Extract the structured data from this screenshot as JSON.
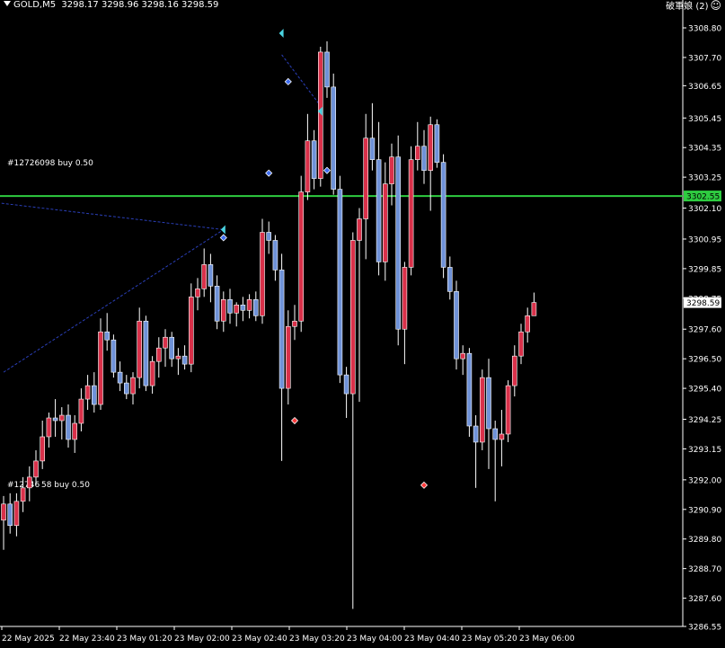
{
  "header": {
    "symbol_tf": "GOLD,M5",
    "ohlc": "3298.17 3298.96 3298.16 3298.59",
    "account": "破軍娘 (2)",
    "smiley": "☺"
  },
  "orders": [
    {
      "label": "#12726098 buy 0.50"
    },
    {
      "label": "#12746 58 buy 0.50"
    }
  ],
  "colors": {
    "background": "#000000",
    "bull": "#d9314a",
    "bear": "#6f92d8",
    "wick": "#ffffff",
    "hline": "#2ecc40",
    "order_arrow": "#4ad3e0",
    "trade_line": "#2a3fb8"
  },
  "chart_data": {
    "type": "candlestick",
    "symbol": "GOLD",
    "timeframe": "M5",
    "y_ticks": [
      "3308.80",
      "3307.70",
      "3306.65",
      "3305.45",
      "3304.35",
      "3303.25",
      "3302.10",
      "3300.95",
      "3299.85",
      "3298.75",
      "3297.60",
      "3296.50",
      "3295.40",
      "3294.25",
      "3293.15",
      "3292.00",
      "3290.90",
      "3289.80",
      "3288.70",
      "3287.60",
      "3286.55"
    ],
    "y_range": [
      3286.55,
      3308.8
    ],
    "x_labels": [
      "22 May 2025",
      "22 May 23:40",
      "23 May 01:20",
      "23 May 02:00",
      "23 May 02:40",
      "23 May 03:20",
      "23 May 04:00",
      "23 May 04:40",
      "23 May 05:20",
      "23 May 06:00"
    ],
    "horizontal_line": {
      "price": 3302.55,
      "label": "3302.55"
    },
    "current_price": {
      "price": 3298.59,
      "label": "3298.59"
    },
    "candles": [
      {
        "o": 3290.5,
        "h": 3291.4,
        "l": 3289.4,
        "c": 3291.1
      },
      {
        "o": 3291.1,
        "h": 3291.5,
        "l": 3290.0,
        "c": 3290.3
      },
      {
        "o": 3290.3,
        "h": 3291.5,
        "l": 3289.9,
        "c": 3291.2
      },
      {
        "o": 3291.2,
        "h": 3292.1,
        "l": 3290.8,
        "c": 3291.7
      },
      {
        "o": 3291.7,
        "h": 3292.5,
        "l": 3291.2,
        "c": 3292.1
      },
      {
        "o": 3292.1,
        "h": 3293.1,
        "l": 3291.8,
        "c": 3292.7
      },
      {
        "o": 3292.7,
        "h": 3294.2,
        "l": 3292.4,
        "c": 3293.6
      },
      {
        "o": 3293.6,
        "h": 3294.5,
        "l": 3293.2,
        "c": 3294.3
      },
      {
        "o": 3294.3,
        "h": 3295.0,
        "l": 3293.6,
        "c": 3294.2
      },
      {
        "o": 3294.2,
        "h": 3294.7,
        "l": 3293.5,
        "c": 3294.4
      },
      {
        "o": 3294.4,
        "h": 3294.8,
        "l": 3293.2,
        "c": 3293.5
      },
      {
        "o": 3293.5,
        "h": 3294.4,
        "l": 3293.0,
        "c": 3294.1
      },
      {
        "o": 3294.1,
        "h": 3295.4,
        "l": 3293.8,
        "c": 3295.0
      },
      {
        "o": 3295.0,
        "h": 3295.9,
        "l": 3294.6,
        "c": 3295.5
      },
      {
        "o": 3295.5,
        "h": 3296.0,
        "l": 3294.5,
        "c": 3294.8
      },
      {
        "o": 3294.8,
        "h": 3298.0,
        "l": 3294.6,
        "c": 3297.5
      },
      {
        "o": 3297.5,
        "h": 3298.2,
        "l": 3296.8,
        "c": 3297.2
      },
      {
        "o": 3297.2,
        "h": 3297.4,
        "l": 3295.8,
        "c": 3296.0
      },
      {
        "o": 3296.0,
        "h": 3296.4,
        "l": 3295.3,
        "c": 3295.6
      },
      {
        "o": 3295.6,
        "h": 3295.9,
        "l": 3295.0,
        "c": 3295.2
      },
      {
        "o": 3295.2,
        "h": 3296.0,
        "l": 3294.8,
        "c": 3295.8
      },
      {
        "o": 3295.8,
        "h": 3298.4,
        "l": 3295.4,
        "c": 3297.9
      },
      {
        "o": 3297.9,
        "h": 3298.1,
        "l": 3295.3,
        "c": 3295.5
      },
      {
        "o": 3295.5,
        "h": 3296.6,
        "l": 3295.2,
        "c": 3296.4
      },
      {
        "o": 3296.4,
        "h": 3297.3,
        "l": 3295.8,
        "c": 3296.9
      },
      {
        "o": 3296.9,
        "h": 3297.6,
        "l": 3296.2,
        "c": 3297.3
      },
      {
        "o": 3297.3,
        "h": 3297.5,
        "l": 3296.2,
        "c": 3296.5
      },
      {
        "o": 3296.5,
        "h": 3296.9,
        "l": 3295.9,
        "c": 3296.6
      },
      {
        "o": 3296.6,
        "h": 3297.0,
        "l": 3296.1,
        "c": 3296.3
      },
      {
        "o": 3296.3,
        "h": 3299.3,
        "l": 3296.0,
        "c": 3298.8
      },
      {
        "o": 3298.8,
        "h": 3299.5,
        "l": 3298.3,
        "c": 3299.1
      },
      {
        "o": 3299.1,
        "h": 3300.6,
        "l": 3298.8,
        "c": 3300.0
      },
      {
        "o": 3300.0,
        "h": 3300.4,
        "l": 3298.6,
        "c": 3299.2
      },
      {
        "o": 3299.2,
        "h": 3299.6,
        "l": 3297.6,
        "c": 3297.9
      },
      {
        "o": 3297.9,
        "h": 3299.0,
        "l": 3297.5,
        "c": 3298.7
      },
      {
        "o": 3298.7,
        "h": 3299.1,
        "l": 3297.8,
        "c": 3298.2
      },
      {
        "o": 3298.2,
        "h": 3298.6,
        "l": 3297.7,
        "c": 3298.5
      },
      {
        "o": 3298.5,
        "h": 3298.8,
        "l": 3297.9,
        "c": 3298.3
      },
      {
        "o": 3298.3,
        "h": 3298.9,
        "l": 3298.0,
        "c": 3298.7
      },
      {
        "o": 3298.7,
        "h": 3299.0,
        "l": 3297.9,
        "c": 3298.1
      },
      {
        "o": 3298.1,
        "h": 3301.7,
        "l": 3297.8,
        "c": 3301.2
      },
      {
        "o": 3301.2,
        "h": 3301.6,
        "l": 3300.4,
        "c": 3300.9
      },
      {
        "o": 3300.9,
        "h": 3301.1,
        "l": 3299.4,
        "c": 3299.8
      },
      {
        "o": 3299.8,
        "h": 3300.4,
        "l": 3292.7,
        "c": 3295.4
      },
      {
        "o": 3295.4,
        "h": 3298.3,
        "l": 3294.8,
        "c": 3297.7
      },
      {
        "o": 3297.7,
        "h": 3298.5,
        "l": 3297.2,
        "c": 3297.9
      },
      {
        "o": 3297.9,
        "h": 3303.3,
        "l": 3297.5,
        "c": 3302.7
      },
      {
        "o": 3302.7,
        "h": 3305.6,
        "l": 3302.4,
        "c": 3304.6
      },
      {
        "o": 3304.6,
        "h": 3305.0,
        "l": 3302.8,
        "c": 3303.2
      },
      {
        "o": 3303.2,
        "h": 3308.1,
        "l": 3302.9,
        "c": 3307.9
      },
      {
        "o": 3307.9,
        "h": 3308.3,
        "l": 3306.2,
        "c": 3306.6
      },
      {
        "o": 3306.6,
        "h": 3307.1,
        "l": 3302.6,
        "c": 3302.8
      },
      {
        "o": 3302.8,
        "h": 3303.3,
        "l": 3295.6,
        "c": 3295.9
      },
      {
        "o": 3295.9,
        "h": 3296.2,
        "l": 3294.3,
        "c": 3295.2
      },
      {
        "o": 3295.2,
        "h": 3301.2,
        "l": 3287.2,
        "c": 3300.9
      },
      {
        "o": 3300.9,
        "h": 3302.1,
        "l": 3294.9,
        "c": 3301.7
      },
      {
        "o": 3301.7,
        "h": 3305.6,
        "l": 3300.2,
        "c": 3304.7
      },
      {
        "o": 3304.7,
        "h": 3306.0,
        "l": 3303.5,
        "c": 3303.9
      },
      {
        "o": 3303.9,
        "h": 3305.3,
        "l": 3299.6,
        "c": 3300.1
      },
      {
        "o": 3300.1,
        "h": 3303.8,
        "l": 3299.4,
        "c": 3303.0
      },
      {
        "o": 3303.0,
        "h": 3304.5,
        "l": 3302.2,
        "c": 3304.0
      },
      {
        "o": 3304.0,
        "h": 3304.8,
        "l": 3297.0,
        "c": 3297.6
      },
      {
        "o": 3297.6,
        "h": 3300.1,
        "l": 3296.3,
        "c": 3299.9
      },
      {
        "o": 3299.9,
        "h": 3304.4,
        "l": 3299.6,
        "c": 3303.9
      },
      {
        "o": 3303.9,
        "h": 3305.3,
        "l": 3303.5,
        "c": 3304.4
      },
      {
        "o": 3304.4,
        "h": 3305.0,
        "l": 3303.0,
        "c": 3303.5
      },
      {
        "o": 3303.5,
        "h": 3305.5,
        "l": 3302.0,
        "c": 3305.2
      },
      {
        "o": 3305.2,
        "h": 3305.4,
        "l": 3303.6,
        "c": 3303.8
      },
      {
        "o": 3303.8,
        "h": 3304.1,
        "l": 3299.5,
        "c": 3299.9
      },
      {
        "o": 3299.9,
        "h": 3300.3,
        "l": 3298.7,
        "c": 3299.0
      },
      {
        "o": 3299.0,
        "h": 3299.4,
        "l": 3296.1,
        "c": 3296.5
      },
      {
        "o": 3296.5,
        "h": 3297.0,
        "l": 3295.9,
        "c": 3296.7
      },
      {
        "o": 3296.7,
        "h": 3296.9,
        "l": 3293.6,
        "c": 3294.0
      },
      {
        "o": 3294.0,
        "h": 3294.4,
        "l": 3291.7,
        "c": 3293.4
      },
      {
        "o": 3293.4,
        "h": 3296.1,
        "l": 3293.1,
        "c": 3295.8
      },
      {
        "o": 3295.8,
        "h": 3296.5,
        "l": 3292.4,
        "c": 3293.9
      },
      {
        "o": 3293.9,
        "h": 3294.2,
        "l": 3291.2,
        "c": 3293.5
      },
      {
        "o": 3293.5,
        "h": 3294.6,
        "l": 3292.5,
        "c": 3293.7
      },
      {
        "o": 3293.7,
        "h": 3295.7,
        "l": 3293.4,
        "c": 3295.5
      },
      {
        "o": 3295.5,
        "h": 3297.0,
        "l": 3295.1,
        "c": 3296.6
      },
      {
        "o": 3296.6,
        "h": 3297.8,
        "l": 3296.3,
        "c": 3297.5
      },
      {
        "o": 3297.5,
        "h": 3298.4,
        "l": 3297.1,
        "c": 3298.1
      },
      {
        "o": 3298.1,
        "h": 3298.96,
        "l": 3298.1,
        "c": 3298.59
      }
    ],
    "trade_lines": [
      {
        "from_bar": 0,
        "from_price": 3296.0,
        "to_bar": 34,
        "to_price": 3301.3
      },
      {
        "from_bar": -1,
        "from_price": 3302.3,
        "to_bar": 34,
        "to_price": 3301.3
      },
      {
        "from_bar": 43,
        "from_price": 3307.8,
        "to_bar": 49,
        "to_price": 3305.9
      }
    ],
    "order_arrows": [
      {
        "bar": 34,
        "price": 3301.3
      },
      {
        "bar": 43,
        "price": 3308.6
      },
      {
        "bar": 49,
        "price": 3305.7
      }
    ],
    "fill_markers": [
      {
        "bar": 34,
        "price": 3301.0,
        "color": "blue"
      },
      {
        "bar": 44,
        "price": 3306.8,
        "color": "blue"
      },
      {
        "bar": 41,
        "price": 3303.4,
        "color": "blue"
      },
      {
        "bar": 50,
        "price": 3303.5,
        "color": "blue"
      },
      {
        "bar": 45,
        "price": 3294.2,
        "color": "red"
      },
      {
        "bar": 65,
        "price": 3291.8,
        "color": "red"
      }
    ]
  }
}
